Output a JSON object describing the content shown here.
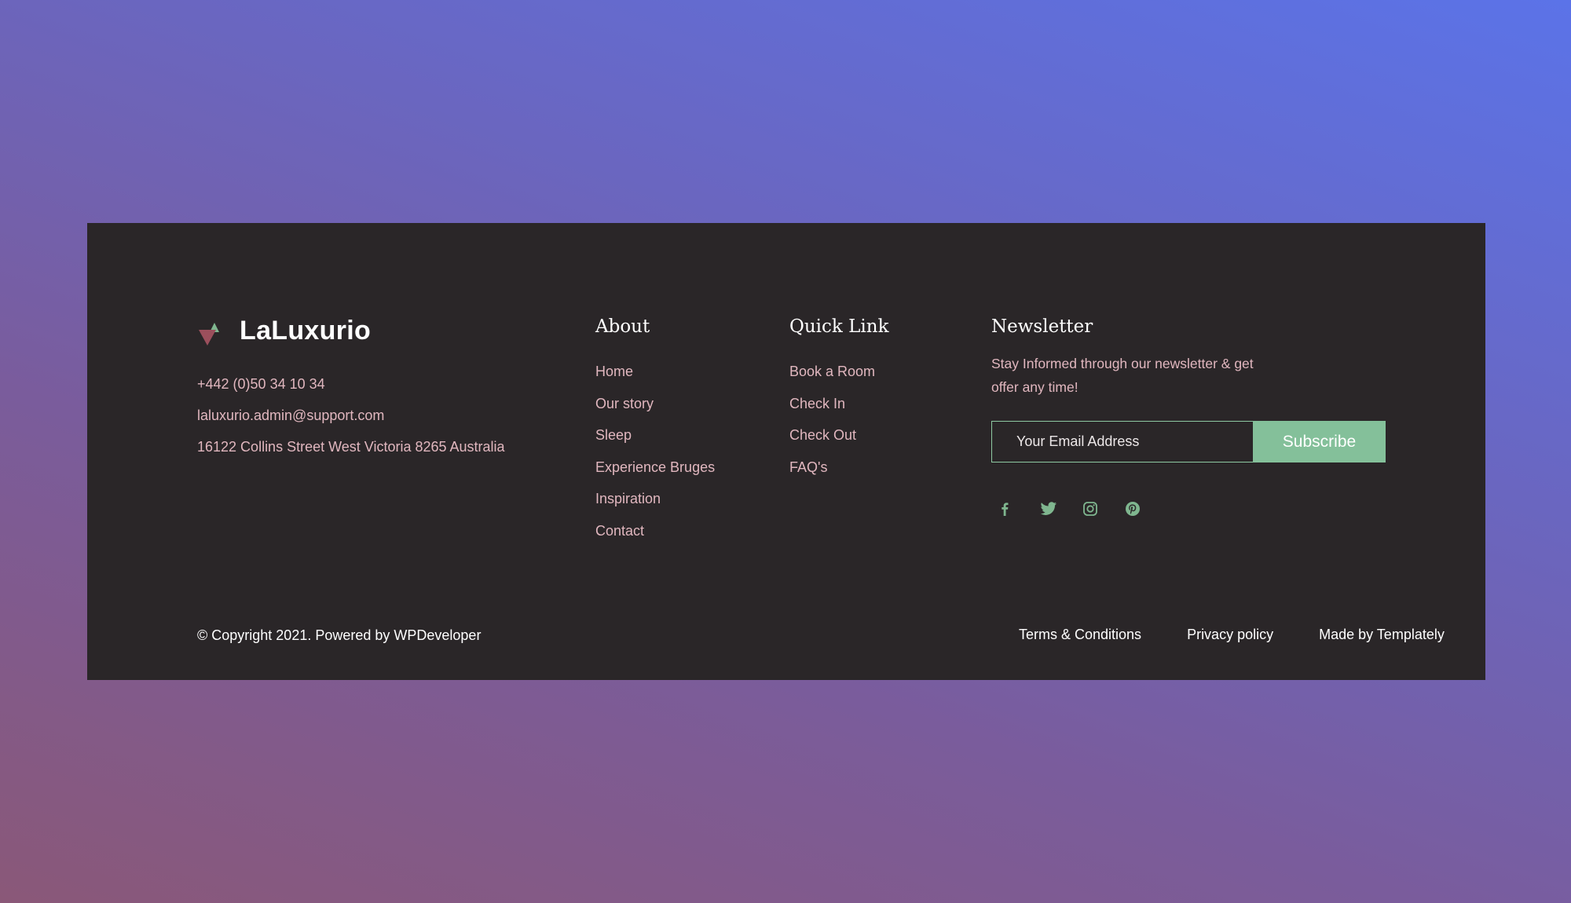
{
  "brand": {
    "name": "LaLuxurio",
    "logo_icon": "triangles-logo-icon",
    "logo_colors": {
      "up_triangle": "#7fb68f",
      "down_triangle": "#9b4f5c"
    }
  },
  "contact": {
    "phone": "+442 (0)50 34 10 34",
    "email": "laluxurio.admin@support.com",
    "address": "16122 Collins Street West Victoria 8265 Australia"
  },
  "about": {
    "heading": "About",
    "links": [
      "Home",
      "Our story",
      "Sleep",
      "Experience Bruges",
      "Inspiration",
      "Contact"
    ]
  },
  "quick_link": {
    "heading": "Quick Link",
    "links": [
      "Book a Room",
      "Check In",
      "Check Out",
      "FAQ's"
    ]
  },
  "newsletter": {
    "heading": "Newsletter",
    "description": "Stay Informed through our newsletter & get offer any time!",
    "email_placeholder": "Your Email Address",
    "subscribe_label": "Subscribe",
    "social_icons": [
      "facebook-icon",
      "twitter-icon",
      "instagram-icon",
      "pinterest-icon"
    ]
  },
  "bottom_bar": {
    "copyright": "© Copyright 2021. Powered by WPDeveloper",
    "links": [
      "Terms & Conditions",
      "Privacy policy",
      "Made by Templately"
    ]
  },
  "colors": {
    "panel_background": "#2a2628",
    "link_text": "#e1b7bf",
    "accent_green": "#84c09a",
    "heading_text": "#ffffff"
  }
}
